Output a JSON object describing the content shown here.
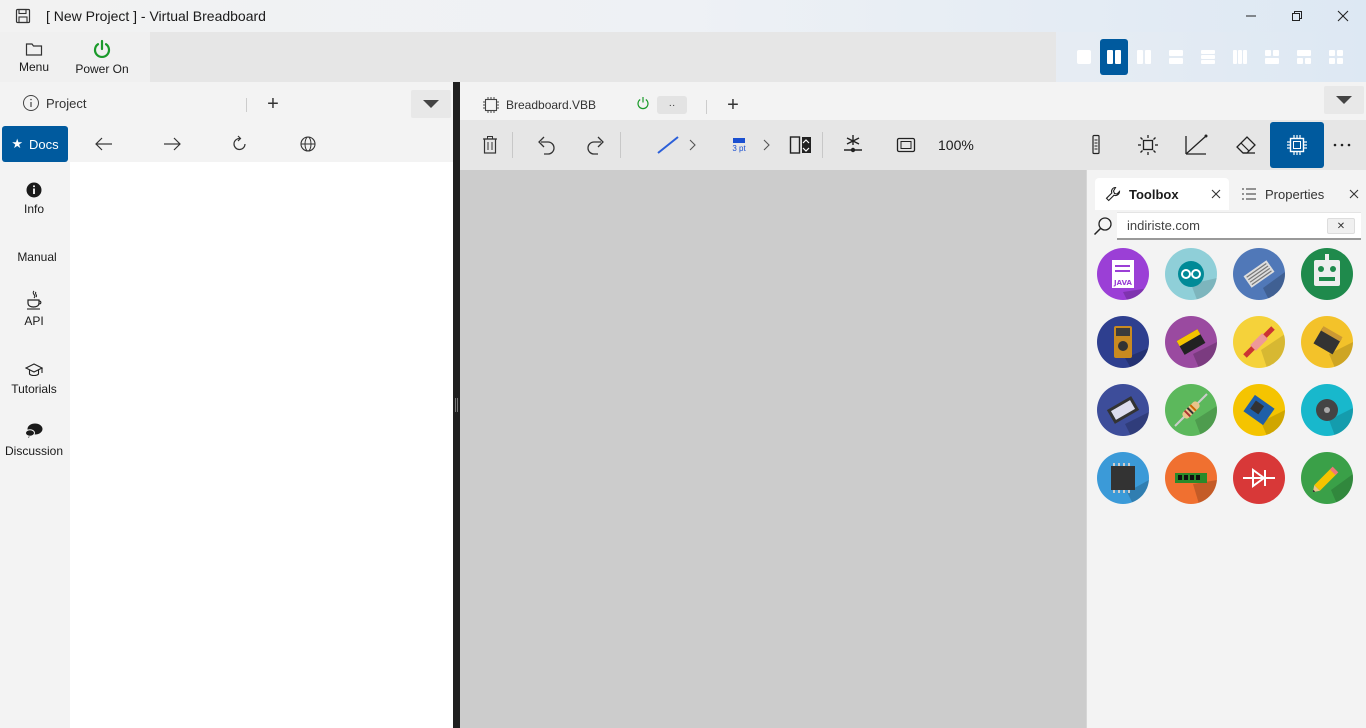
{
  "window": {
    "title": "[ New Project ] - Virtual Breadboard"
  },
  "ribbon": {
    "menu_label": "Menu",
    "power_label": "Power On"
  },
  "left_panel": {
    "project_tab_label": "Project",
    "docs_label": "Docs",
    "side_items": [
      {
        "label": "Info",
        "icon": "info-icon"
      },
      {
        "label": "Manual",
        "icon": ""
      },
      {
        "label": "API",
        "icon": "java-icon"
      },
      {
        "label": "Tutorials",
        "icon": "graduation-cap-icon"
      },
      {
        "label": "Discussion",
        "icon": "chat-bubbles-icon"
      }
    ]
  },
  "right_panel": {
    "file_tab_label": "Breadboard.VBB",
    "file_tab_more": "··",
    "stroke_label": "3 pt",
    "zoom_label": "100%"
  },
  "toolbox": {
    "tab_toolbox": "Toolbox",
    "tab_properties": "Properties",
    "search_value": "indiriste.com",
    "clear_label": "✕",
    "tools": [
      {
        "name": "java-file-icon",
        "color": "#9b3fd6"
      },
      {
        "name": "arduino-icon",
        "color": "#8fcfd8"
      },
      {
        "name": "breadboard-icon",
        "color": "#5078b8"
      },
      {
        "name": "robot-icon",
        "color": "#1f8a4c"
      },
      {
        "name": "multimeter-icon",
        "color": "#2e3f8f"
      },
      {
        "name": "led-chip-icon",
        "color": "#9a4aa0"
      },
      {
        "name": "capacitor-icon",
        "color": "#f5d23a"
      },
      {
        "name": "transistor-icon",
        "color": "#f3c22a"
      },
      {
        "name": "lcd-display-icon",
        "color": "#3d4d9a"
      },
      {
        "name": "resistor-icon",
        "color": "#5cb85c"
      },
      {
        "name": "shield-board-icon",
        "color": "#f5c400"
      },
      {
        "name": "buzzer-icon",
        "color": "#18b8cc"
      },
      {
        "name": "microchip-icon",
        "color": "#3b9ad8"
      },
      {
        "name": "memory-module-icon",
        "color": "#f07030"
      },
      {
        "name": "diode-icon",
        "color": "#d83838"
      },
      {
        "name": "pencil-icon",
        "color": "#3aa048"
      }
    ]
  },
  "colors": {
    "accent": "#005a9e",
    "power_green": "#1a9a2a",
    "canvas": "#cccccc"
  }
}
